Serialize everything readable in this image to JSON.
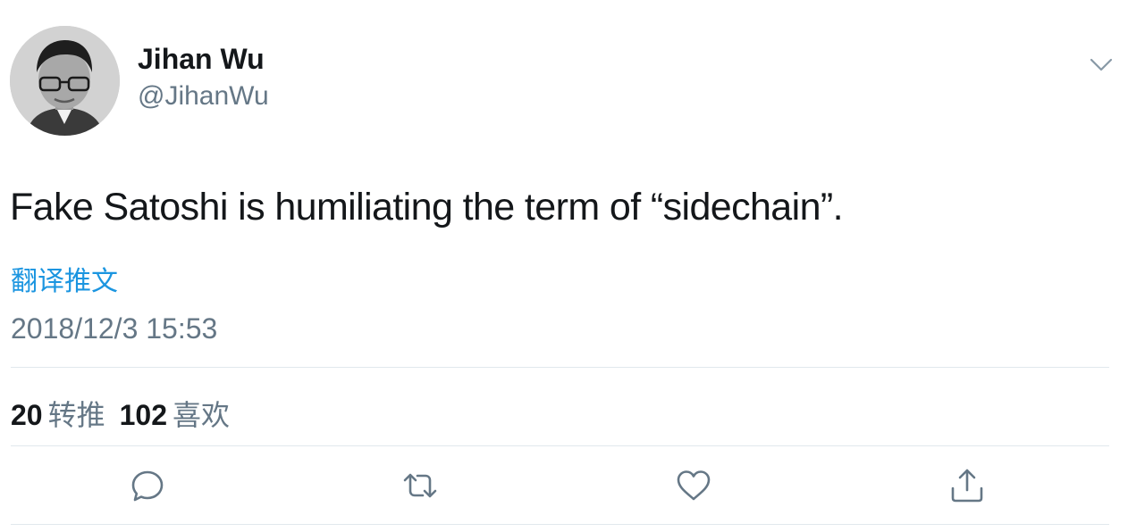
{
  "author": {
    "display_name": "Jihan Wu",
    "handle": "@JihanWu"
  },
  "tweet": {
    "text": "Fake Satoshi is humiliating the term of “sidechain”.",
    "translate_label": "翻译推文",
    "timestamp": "2018/12/3 15:53"
  },
  "stats": {
    "retweets_count": "20",
    "retweets_label": "转推",
    "likes_count": "102",
    "likes_label": "喜欢"
  },
  "icons": {
    "menu": "chevron-down-icon",
    "reply": "reply-icon",
    "retweet": "retweet-icon",
    "like": "heart-icon",
    "share": "share-icon"
  },
  "colors": {
    "text": "#14171a",
    "secondary": "#657786",
    "link": "#1b95e0",
    "divider": "#e1e8ed"
  }
}
